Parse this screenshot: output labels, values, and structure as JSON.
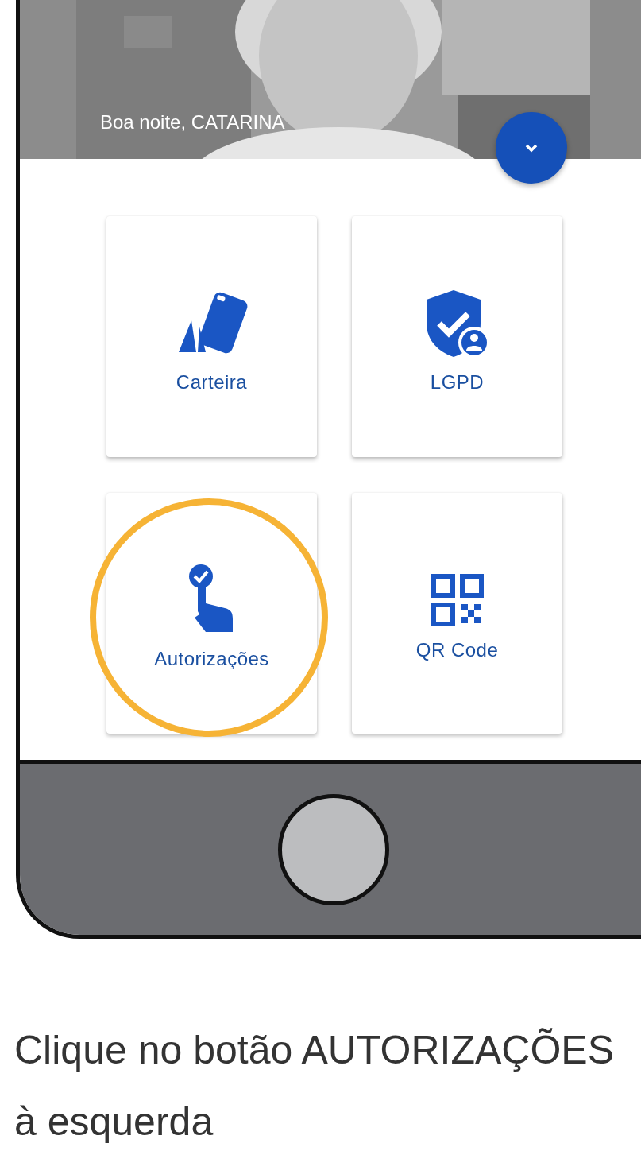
{
  "header": {
    "greeting": "Boa noite, CATARINA"
  },
  "menu": [
    {
      "label": "Carteira",
      "kind": "cards",
      "highlighted": false
    },
    {
      "label": "LGPD",
      "kind": "shield",
      "highlighted": false
    },
    {
      "label": "Autorizações",
      "kind": "touch",
      "highlighted": true
    },
    {
      "label": "QR Code",
      "kind": "qr",
      "highlighted": false
    }
  ],
  "instruction": "Clique no botão AUTORIZAÇÕES à esquerda"
}
